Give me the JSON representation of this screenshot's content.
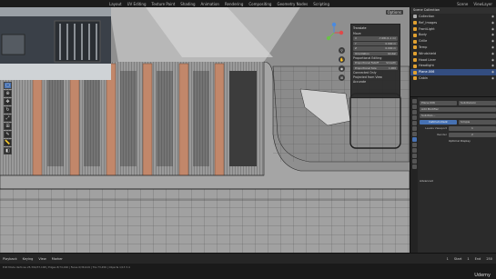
{
  "topbar": {
    "tabs": [
      "Layout",
      "UV Editing",
      "Texture Paint",
      "Shading",
      "Animation",
      "Rendering",
      "Compositing",
      "Geometry Nodes",
      "Scripting"
    ],
    "scene_label": "Scene",
    "viewlayer_label": "ViewLayer"
  },
  "toolbar": {
    "tools": [
      "select",
      "cursor",
      "move",
      "rotate",
      "scale",
      "transform",
      "annotate",
      "measure",
      "add-cube"
    ]
  },
  "vp_header": {
    "options_label": "Options"
  },
  "npanel": {
    "title": "Translate",
    "move_label": "Move",
    "x_label": "X",
    "x_value": "-7.081(1.1 m)",
    "y_label": "Y",
    "y_value": "0.000 m",
    "z_label": "Z",
    "z_value": "0.000 m",
    "orient_label": "Orientation",
    "orient_value": "Global",
    "prop_label": "Proportional Editing",
    "falloff_label": "Proportional Falloff",
    "falloff_value": "Smooth",
    "size_label": "Proportional Size",
    "size_value": "1.000",
    "connected_label": "Connected Only",
    "projected_label": "Projected from View",
    "accurate_label": "Accurate"
  },
  "outliner": {
    "title": "Scene Collection",
    "rows": [
      {
        "label": "Collection",
        "selected": false
      },
      {
        "label": "Ref_Images",
        "selected": false
      },
      {
        "label": "FrontLight",
        "selected": false
      },
      {
        "label": "Body",
        "selected": false
      },
      {
        "label": "Grille",
        "selected": false
      },
      {
        "label": "Temp",
        "selected": false
      },
      {
        "label": "Windshield",
        "selected": false
      },
      {
        "label": "Hood Liner",
        "selected": false
      },
      {
        "label": "Headlight",
        "selected": false
      },
      {
        "label": "Plane.006",
        "selected": true
      },
      {
        "label": "Cabin",
        "selected": false
      }
    ]
  },
  "props": {
    "object_name": "Plane.006",
    "modifier_name": "Subdivision",
    "add_modifier": "Add Modifier",
    "subdiv_name": "Subdivis...",
    "catmull_label": "Catmull-Clark",
    "simple_label": "Simple",
    "levels_viewport_label": "Levels Viewport",
    "levels_viewport_value": "1",
    "render_label": "Render",
    "render_value": "2",
    "optimal_label": "Optimal Display",
    "advanced_label": "Advanced"
  },
  "timeline": {
    "playback": "Playback",
    "keying": "Keying",
    "view": "View",
    "marker": "Marker",
    "start_label": "Start",
    "start_value": "1",
    "end_label": "End",
    "end_value": "250",
    "current_frame": "1"
  },
  "statusbar": {
    "text": "Edit Mode  Vertices 25,394/37,168 | Edges 8/74,196 | Faces 0/36,919 | Tris 73,456 | Objects 1/13  3.4",
    "udemy": "Udemy"
  },
  "colors": {
    "accent": "#4772b3",
    "selected_row": "#334d80",
    "wood": "#c2876a"
  }
}
